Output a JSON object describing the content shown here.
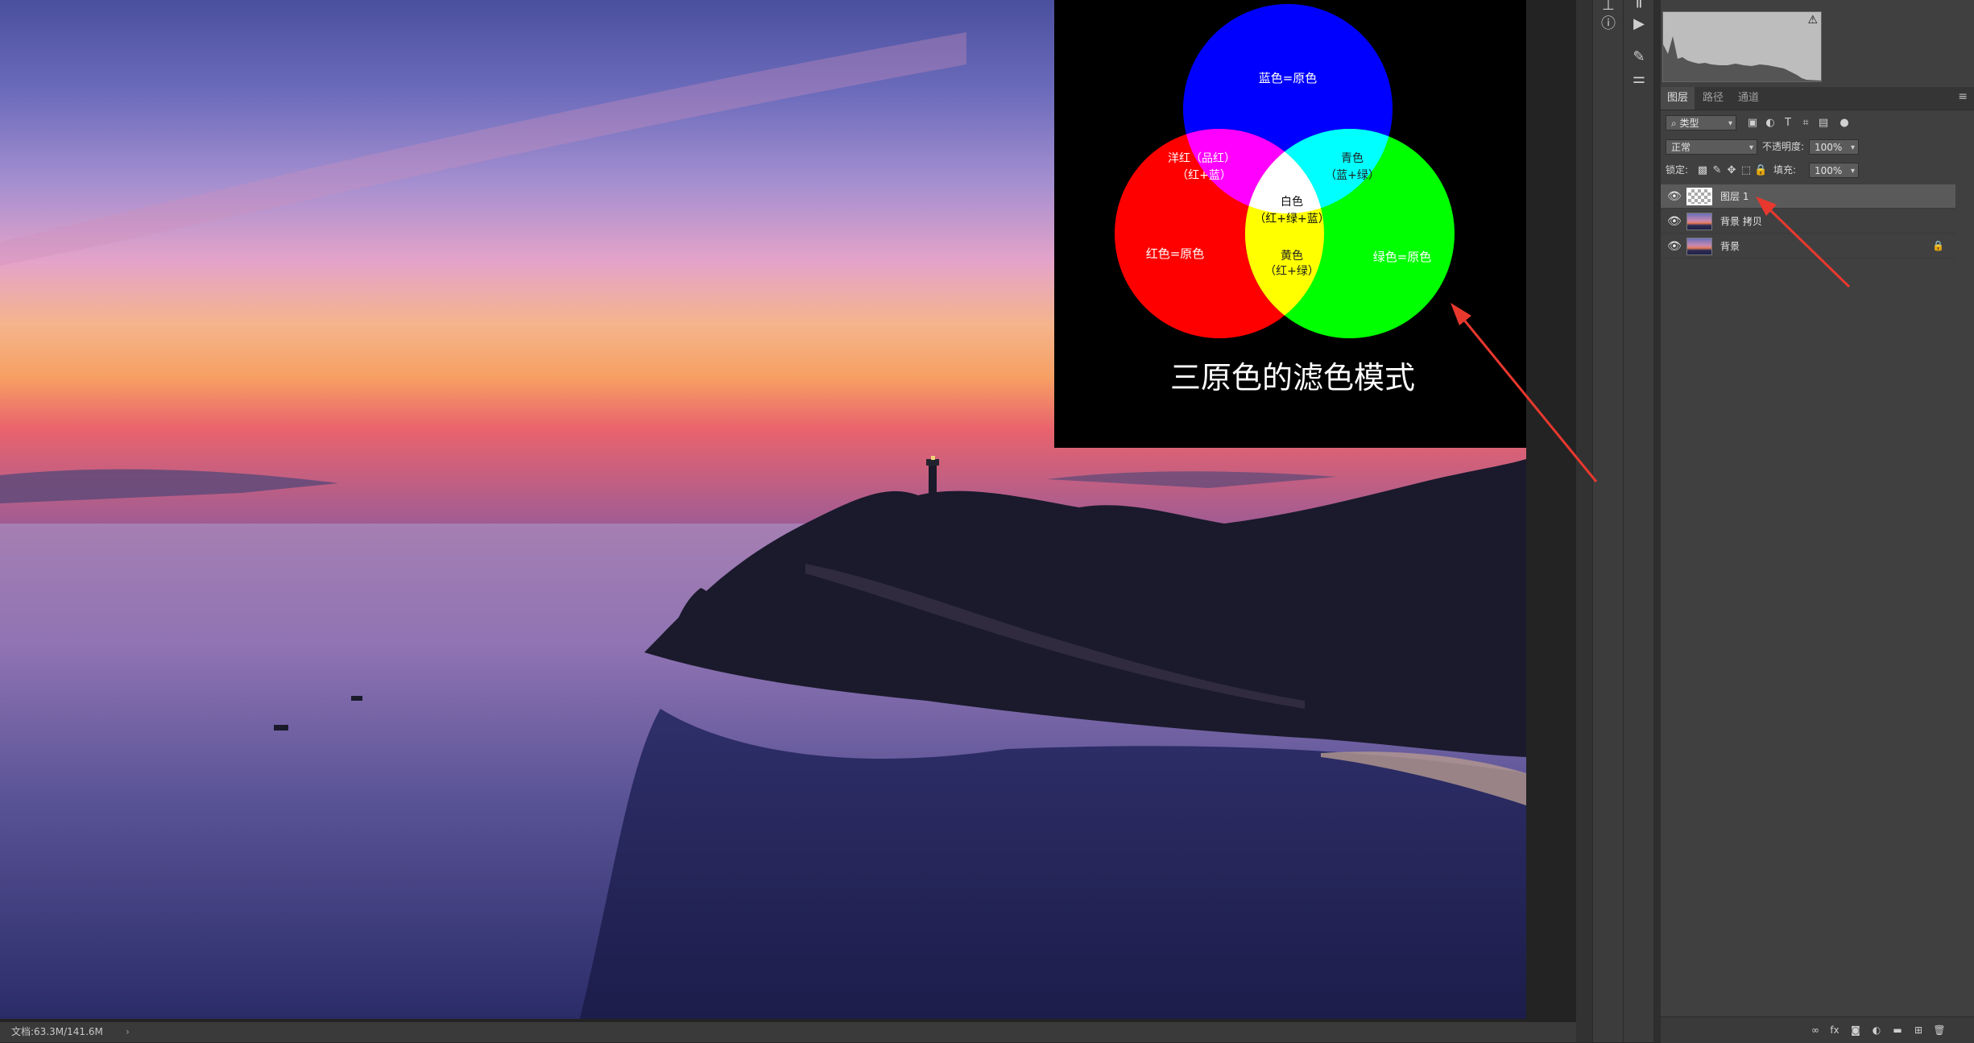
{
  "inset": {
    "title": "三原色的滤色模式",
    "circle_blue": "蓝色=原色",
    "circle_red": "红色=原色",
    "circle_green": "绿色=原色",
    "magenta_l1": "洋红（品红）",
    "magenta_l2": "（红+蓝）",
    "cyan_l1": "青色",
    "cyan_l2": "（蓝+绿）",
    "white_l1": "白色",
    "white_l2": "（红+绿+蓝）",
    "yellow_l1": "黄色",
    "yellow_l2": "（红+绿）"
  },
  "status": {
    "doc_size": "文档:63.3M/141.6M",
    "chevron": "›"
  },
  "panel": {
    "histogram_warning": "⚠",
    "tabs": [
      {
        "label": "图层"
      },
      {
        "label": "路径"
      },
      {
        "label": "通道"
      }
    ],
    "panel_menu": "≡",
    "filter_kind": "类型",
    "blend_mode": "正常",
    "opacity_label": "不透明度:",
    "opacity_value": "100%",
    "lock_label": "锁定:",
    "fill_label": "填充:",
    "fill_value": "100%",
    "layers": [
      {
        "name": "图层 1",
        "thumb": "checker",
        "active": true
      },
      {
        "name": "背景 拷贝",
        "thumb": "image",
        "active": false
      },
      {
        "name": "背景",
        "thumb": "image",
        "active": false,
        "locked": true
      }
    ]
  },
  "colors": {
    "annotation_arrow": "#e8382e",
    "panel_bg": "#404040",
    "active_layer": "#5a5a5a"
  },
  "icons": {
    "layer_visibility": "eye-icon",
    "lock": "lock-icon",
    "warning": "warning-icon"
  }
}
